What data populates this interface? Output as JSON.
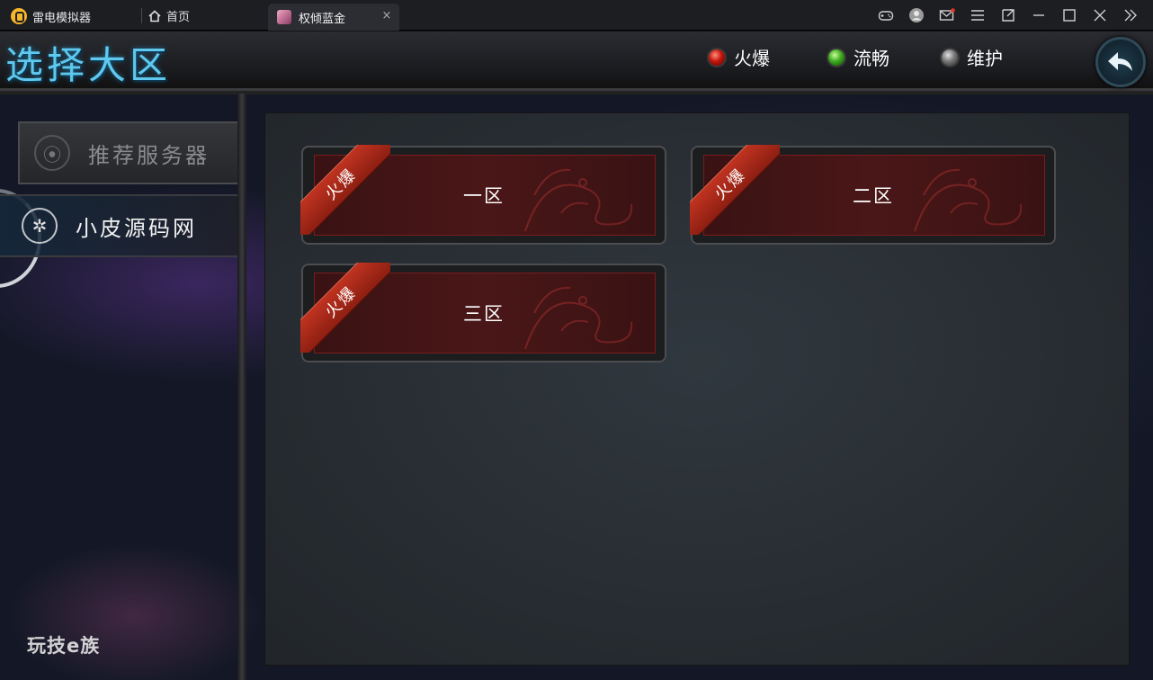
{
  "titlebar": {
    "app_name": "雷电模拟器",
    "home_tab": "首页",
    "game_tab": "权倾蓝金",
    "close_glyph": "×"
  },
  "header": {
    "title": "选择大区",
    "legend": [
      {
        "label": "火爆",
        "color": "#c3140c"
      },
      {
        "label": "流畅",
        "color": "#3da91f"
      },
      {
        "label": "维护",
        "color": "#777777"
      }
    ]
  },
  "sidebar": {
    "items": [
      {
        "label": "推荐服务器",
        "active": false
      },
      {
        "label": "小皮源码网",
        "active": true
      }
    ]
  },
  "servers": [
    {
      "name": "一区",
      "badge": "火爆"
    },
    {
      "name": "二区",
      "badge": "火爆"
    },
    {
      "name": "三区",
      "badge": "火爆"
    }
  ],
  "watermark": "玩技e族"
}
